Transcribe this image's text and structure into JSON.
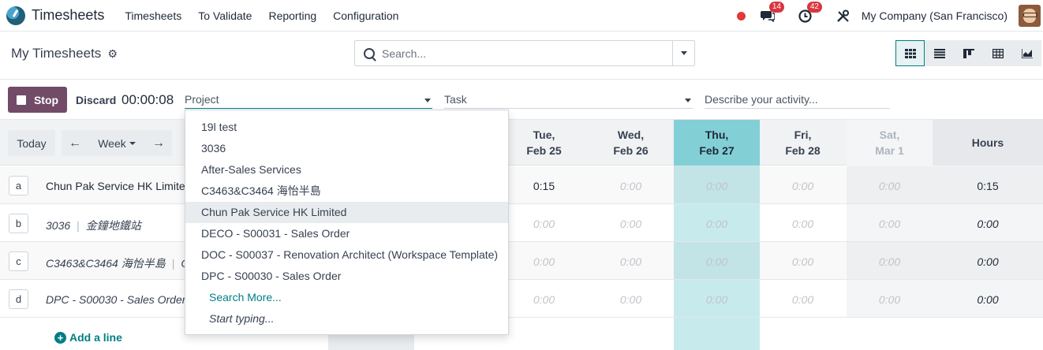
{
  "navbar": {
    "app_name": "Timesheets",
    "menu": [
      "Timesheets",
      "To Validate",
      "Reporting",
      "Configuration"
    ],
    "messages_badge": "14",
    "activities_badge": "42",
    "company": "My Company (San Francisco)"
  },
  "control": {
    "title": "My Timesheets",
    "search_placeholder": "Search...",
    "views": [
      "grid-icon",
      "list-icon",
      "kanban-icon",
      "pivot-icon",
      "graph-icon"
    ]
  },
  "timer": {
    "stop_label": "Stop",
    "discard_label": "Discard",
    "elapsed": "00:00:08",
    "project_placeholder": "Project",
    "task_placeholder": "Task",
    "description_placeholder": "Describe your activity..."
  },
  "grid": {
    "today_label": "Today",
    "range_label": "Week",
    "columns": [
      {
        "day": "Tue,",
        "date": "Feb 25"
      },
      {
        "day": "Wed,",
        "date": "Feb 26"
      },
      {
        "day": "Thu,",
        "date": "Feb 27"
      },
      {
        "day": "Fri,",
        "date": "Feb 28"
      },
      {
        "day": "Sat,",
        "date": "Mar 1"
      }
    ],
    "total_header": "Hours",
    "rows": [
      {
        "key": "a",
        "label": "Chun Pak Service HK Limited",
        "sub": "",
        "cells": [
          "0:15",
          "0:00",
          "0:00",
          "0:00",
          "0:00"
        ],
        "total": "0:15"
      },
      {
        "key": "b",
        "label": "3036",
        "sub": "金鐘地鐵站",
        "cells": [
          "0:00",
          "0:00",
          "0:00",
          "0:00",
          "0:00"
        ],
        "total": "0:00"
      },
      {
        "key": "c",
        "label": "C3463&C3464 海怡半島",
        "sub": "C",
        "cells": [
          "0:00",
          "0:00",
          "0:00",
          "0:00",
          "0:00"
        ],
        "total": "0:00"
      },
      {
        "key": "d",
        "label": "DPC - S00030 - Sales Order",
        "sub": "",
        "cells": [
          "0:00",
          "0:00",
          "0:00",
          "0:00",
          "0:00"
        ],
        "total": "0:00"
      }
    ],
    "add_line": "Add a line"
  },
  "dropdown": {
    "items": [
      "19l test",
      "3036",
      "After-Sales Services",
      "C3463&C3464 海怡半島",
      "Chun Pak Service HK Limited",
      "DECO - S00031 - Sales Order",
      "DOC - S00037 - Renovation Architect (Workspace Template)",
      "DPC - S00030 - Sales Order"
    ],
    "search_more": "Search More...",
    "start_typing": "Start typing..."
  }
}
